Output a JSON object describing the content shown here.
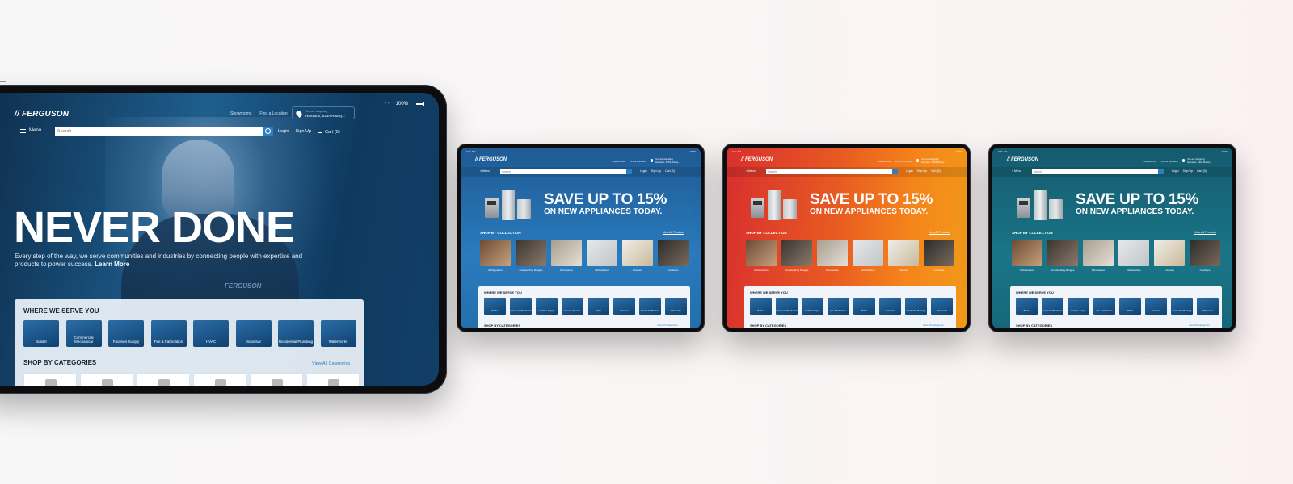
{
  "brand": "FERGUSON",
  "big": {
    "status": {
      "battery": "100%"
    },
    "header_links": [
      "Showrooms",
      "Find a Location"
    ],
    "location": {
      "label": "You are shopping",
      "value": "Hampton, 533A Rotary..."
    },
    "menu": "Menu",
    "search_placeholder": "Search",
    "account": {
      "login": "Login",
      "signup": "Sign Up",
      "cart": "Cart (0)"
    },
    "hero": {
      "title": "NEVER DONE",
      "subtitle": "Every step of the way, we serve communities and industries by connecting people with expertise and products to power success.",
      "learn_more": "Learn More",
      "shirt_logo": "FERGUSON"
    },
    "serve": {
      "heading": "WHERE WE SERVE YOU",
      "tiles": [
        "Builder",
        "Commercial Mechanical",
        "Facilities Supply",
        "Fire & Fabrication",
        "HVAC",
        "Industrial",
        "Residential Plumbing",
        "Waterworks"
      ]
    },
    "categories": {
      "heading": "SHOP BY CATEGORIES",
      "view_all": "View All Categories"
    }
  },
  "small": {
    "time": "9:41 AM",
    "status": "100%",
    "header_links": [
      "Showrooms",
      "Find a Location"
    ],
    "location": {
      "label": "You are shopping",
      "value": "Hampton, 533A Rotary..."
    },
    "menu": "Menu",
    "search_placeholder": "Search",
    "account": {
      "login": "Login",
      "signup": "Sign Up",
      "cart": "Cart (0)"
    },
    "promo": {
      "line1": "SAVE UP TO 15%",
      "line2": "ON NEW APPLIANCES TODAY."
    },
    "collection": {
      "heading": "SHOP BY COLLECTION",
      "view_all": "View All Products",
      "items": [
        "Refrigerators",
        "Freestanding Ranges",
        "Microwaves",
        "Dishwashers",
        "Freezers",
        "Cooktops"
      ]
    },
    "serve": {
      "heading": "WHERE WE SERVE YOU",
      "tiles": [
        "Builder",
        "Commercial Mechanical",
        "Facilities Supply",
        "Fire & Fabrication",
        "HVAC",
        "Industrial",
        "Residential Plumbing",
        "Waterworks"
      ]
    },
    "categories": {
      "heading": "SHOP BY CATEGORIES",
      "view_all": "View All Categories"
    }
  },
  "variant_colors": [
    "#2a7bbd",
    "#e85a22",
    "#1a7588"
  ]
}
